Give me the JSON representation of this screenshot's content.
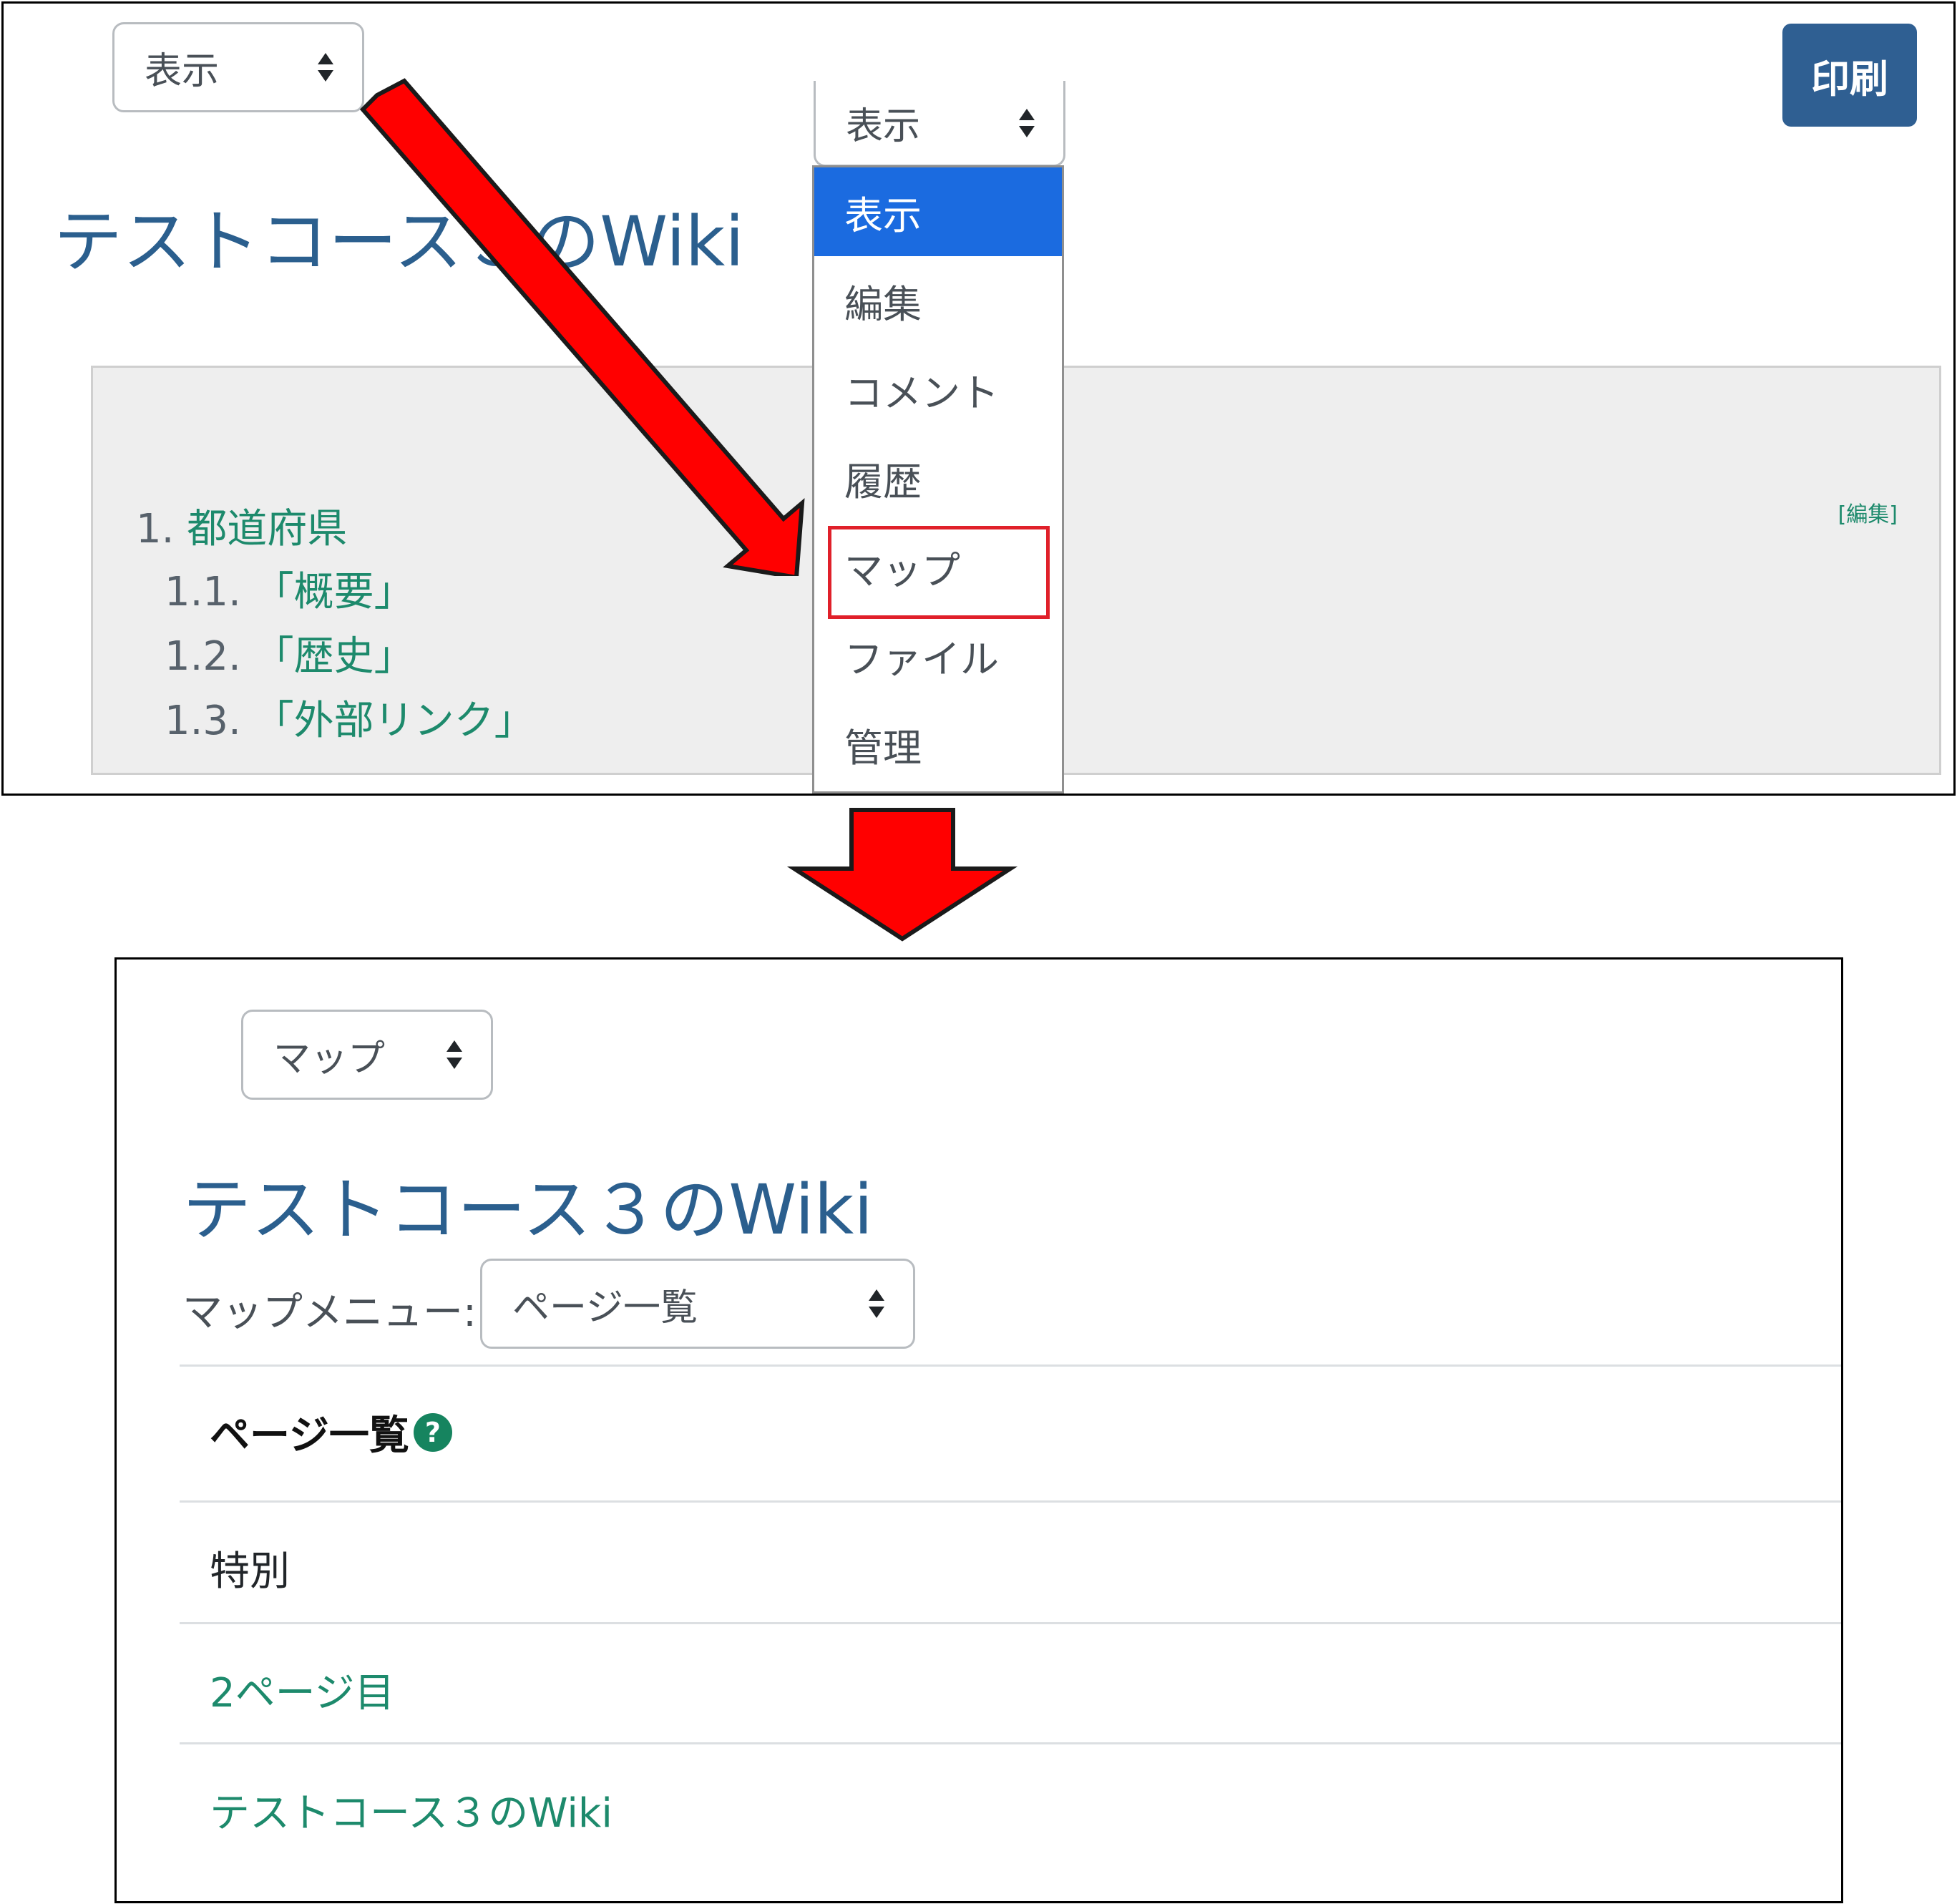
{
  "top": {
    "view_select_value": "表示",
    "print_label": "印刷",
    "page_title": "テストコース３のWiki",
    "toc": {
      "edit_label": "[編集]",
      "items": [
        {
          "number": "1.",
          "label": "都道府県"
        },
        {
          "number": "1.1.",
          "label": "「概要」"
        },
        {
          "number": "1.2.",
          "label": "「歴史」"
        },
        {
          "number": "1.3.",
          "label": "「外部リンク」"
        }
      ]
    },
    "dropdown": {
      "value": "表示",
      "options": [
        "表示",
        "編集",
        "コメント",
        "履歴",
        "マップ",
        "ファイル",
        "管理"
      ],
      "selected_index": 0,
      "highlighted_option": "マップ"
    }
  },
  "bottom": {
    "view_select_value": "マップ",
    "page_title": "テストコース３のWiki",
    "map_menu_label": "マップメニュー:",
    "map_menu_value": "ページ一覧",
    "list_heading": "ページ一覧",
    "help_icon_text": "?",
    "pages": [
      {
        "label": "特別",
        "is_link": false
      },
      {
        "label": "2ページ目",
        "is_link": true
      },
      {
        "label": "テストコース３のWiki",
        "is_link": true
      }
    ]
  },
  "colors": {
    "title": "#2b5f8e",
    "link": "#1d8a6c",
    "print_button": "#2f5f92",
    "selected_option": "#1b6be0",
    "highlight_border": "#e0202a",
    "annotation_arrow": "#ff0000"
  },
  "icons": {
    "select_caret": "up-down-caret-icon",
    "help": "question-circle-icon"
  }
}
